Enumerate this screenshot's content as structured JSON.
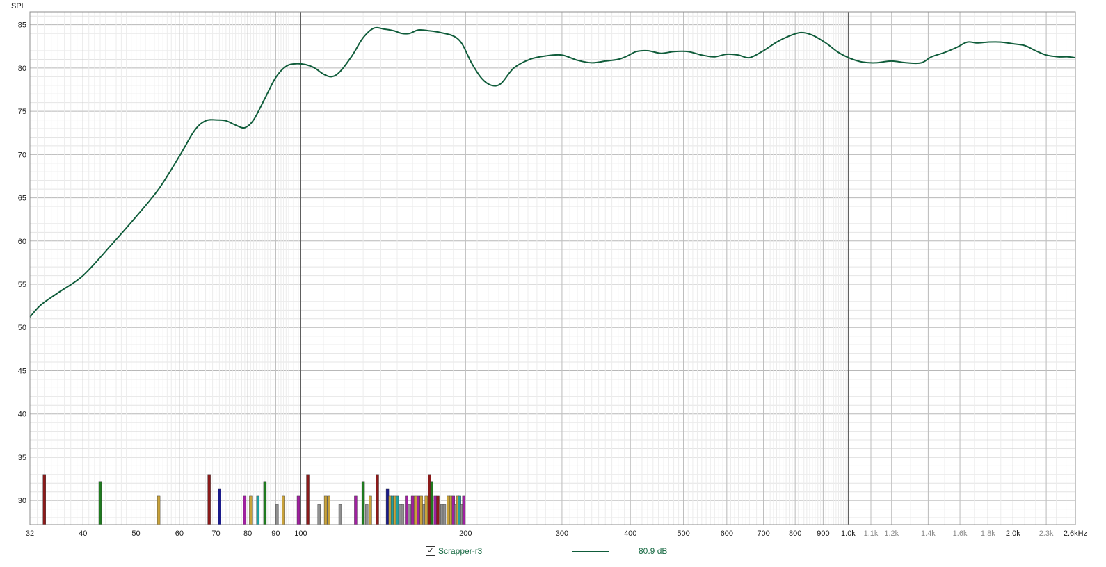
{
  "chart_data": {
    "type": "line",
    "ylabel": "SPL",
    "ylim": [
      27.2,
      86.5
    ],
    "xlim": [
      32,
      2600
    ],
    "xscale": "log",
    "grid": true,
    "y_ticks": [
      30,
      35,
      40,
      45,
      50,
      55,
      60,
      65,
      70,
      75,
      80,
      85
    ],
    "x_ticks": [
      {
        "v": 32,
        "t": "32",
        "minor": false
      },
      {
        "v": 40,
        "t": "40",
        "minor": false
      },
      {
        "v": 50,
        "t": "50",
        "minor": false
      },
      {
        "v": 60,
        "t": "60",
        "minor": false
      },
      {
        "v": 70,
        "t": "70",
        "minor": false
      },
      {
        "v": 80,
        "t": "80",
        "minor": false
      },
      {
        "v": 90,
        "t": "90",
        "minor": false
      },
      {
        "v": 100,
        "t": "100",
        "minor": false
      },
      {
        "v": 200,
        "t": "200",
        "minor": false
      },
      {
        "v": 300,
        "t": "300",
        "minor": false
      },
      {
        "v": 400,
        "t": "400",
        "minor": false
      },
      {
        "v": 500,
        "t": "500",
        "minor": false
      },
      {
        "v": 600,
        "t": "600",
        "minor": false
      },
      {
        "v": 700,
        "t": "700",
        "minor": false
      },
      {
        "v": 800,
        "t": "800",
        "minor": false
      },
      {
        "v": 900,
        "t": "900",
        "minor": false
      },
      {
        "v": 1000,
        "t": "1.0k",
        "minor": false
      },
      {
        "v": 1100,
        "t": "1.1k",
        "minor": true
      },
      {
        "v": 1200,
        "t": "1.2k",
        "minor": true
      },
      {
        "v": 1400,
        "t": "1.4k",
        "minor": true
      },
      {
        "v": 1600,
        "t": "1.6k",
        "minor": true
      },
      {
        "v": 1800,
        "t": "1.8k",
        "minor": true
      },
      {
        "v": 2000,
        "t": "2.0k",
        "minor": false
      },
      {
        "v": 2300,
        "t": "2.3k",
        "minor": true
      },
      {
        "v": 2600,
        "t": "2.6kHz",
        "minor": false
      }
    ],
    "series": [
      {
        "name": "Scrapper-r3",
        "color": "#0f5c3a",
        "points": [
          [
            32,
            51.2
          ],
          [
            33.5,
            52.6
          ],
          [
            36,
            54.0
          ],
          [
            40,
            56.0
          ],
          [
            45,
            59.5
          ],
          [
            50,
            62.8
          ],
          [
            55,
            66.0
          ],
          [
            60,
            69.8
          ],
          [
            64,
            72.8
          ],
          [
            67,
            73.9
          ],
          [
            70,
            74.0
          ],
          [
            73,
            73.9
          ],
          [
            76,
            73.4
          ],
          [
            79,
            73.1
          ],
          [
            82,
            74.0
          ],
          [
            86,
            76.5
          ],
          [
            90,
            78.9
          ],
          [
            94,
            80.2
          ],
          [
            98,
            80.5
          ],
          [
            102,
            80.4
          ],
          [
            106,
            80.0
          ],
          [
            110,
            79.3
          ],
          [
            114,
            79.0
          ],
          [
            118,
            79.6
          ],
          [
            124,
            81.4
          ],
          [
            130,
            83.5
          ],
          [
            136,
            84.6
          ],
          [
            142,
            84.5
          ],
          [
            148,
            84.3
          ],
          [
            153,
            84.0
          ],
          [
            158,
            84.0
          ],
          [
            164,
            84.4
          ],
          [
            172,
            84.3
          ],
          [
            180,
            84.1
          ],
          [
            190,
            83.7
          ],
          [
            197,
            82.8
          ],
          [
            205,
            80.6
          ],
          [
            214,
            78.8
          ],
          [
            223,
            78.0
          ],
          [
            232,
            78.2
          ],
          [
            245,
            80.0
          ],
          [
            262,
            81.0
          ],
          [
            280,
            81.4
          ],
          [
            300,
            81.5
          ],
          [
            320,
            80.9
          ],
          [
            340,
            80.6
          ],
          [
            360,
            80.8
          ],
          [
            380,
            81.0
          ],
          [
            395,
            81.4
          ],
          [
            410,
            81.9
          ],
          [
            430,
            82.0
          ],
          [
            455,
            81.7
          ],
          [
            480,
            81.9
          ],
          [
            510,
            81.9
          ],
          [
            540,
            81.5
          ],
          [
            570,
            81.3
          ],
          [
            600,
            81.6
          ],
          [
            630,
            81.5
          ],
          [
            660,
            81.2
          ],
          [
            700,
            82.0
          ],
          [
            740,
            83.0
          ],
          [
            780,
            83.7
          ],
          [
            820,
            84.1
          ],
          [
            860,
            83.8
          ],
          [
            910,
            82.9
          ],
          [
            960,
            81.8
          ],
          [
            1010,
            81.1
          ],
          [
            1060,
            80.7
          ],
          [
            1120,
            80.6
          ],
          [
            1200,
            80.8
          ],
          [
            1280,
            80.6
          ],
          [
            1360,
            80.6
          ],
          [
            1420,
            81.3
          ],
          [
            1500,
            81.8
          ],
          [
            1580,
            82.4
          ],
          [
            1650,
            83.0
          ],
          [
            1720,
            82.9
          ],
          [
            1800,
            83.0
          ],
          [
            1900,
            83.0
          ],
          [
            2000,
            82.8
          ],
          [
            2100,
            82.6
          ],
          [
            2200,
            82.0
          ],
          [
            2300,
            81.5
          ],
          [
            2420,
            81.3
          ],
          [
            2520,
            81.3
          ],
          [
            2600,
            81.2
          ]
        ]
      }
    ],
    "bars": {
      "floor": 27.2,
      "items": [
        {
          "f": 34,
          "v": 33.0,
          "c": "#8b1a1a"
        },
        {
          "f": 43,
          "v": 32.2,
          "c": "#1f7a1f"
        },
        {
          "f": 55,
          "v": 30.5,
          "c": "#c9a23a"
        },
        {
          "f": 68,
          "v": 33.0,
          "c": "#8b1a1a"
        },
        {
          "f": 71,
          "v": 31.3,
          "c": "#1a1a8b"
        },
        {
          "f": 79,
          "v": 30.5,
          "c": "#a020a0"
        },
        {
          "f": 81,
          "v": 30.5,
          "c": "#c9a23a"
        },
        {
          "f": 83.5,
          "v": 30.5,
          "c": "#20a0a0"
        },
        {
          "f": 86,
          "v": 32.2,
          "c": "#1f7a1f"
        },
        {
          "f": 90.5,
          "v": 29.5,
          "c": "#909090"
        },
        {
          "f": 93,
          "v": 30.5,
          "c": "#c9a23a"
        },
        {
          "f": 99,
          "v": 30.5,
          "c": "#a020a0"
        },
        {
          "f": 103,
          "v": 33.0,
          "c": "#8b1a1a"
        },
        {
          "f": 108,
          "v": 29.5,
          "c": "#909090"
        },
        {
          "f": 111,
          "v": 30.5,
          "c": "#c9a23a"
        },
        {
          "f": 112.5,
          "v": 30.5,
          "c": "#c9a23a"
        },
        {
          "f": 118,
          "v": 29.5,
          "c": "#909090"
        },
        {
          "f": 126,
          "v": 30.5,
          "c": "#a020a0"
        },
        {
          "f": 130,
          "v": 32.2,
          "c": "#1f7a1f"
        },
        {
          "f": 132,
          "v": 29.5,
          "c": "#909090"
        },
        {
          "f": 134,
          "v": 30.5,
          "c": "#c9a23a"
        },
        {
          "f": 138,
          "v": 33.0,
          "c": "#8b1a1a"
        },
        {
          "f": 144,
          "v": 31.3,
          "c": "#1a1a8b"
        },
        {
          "f": 145.5,
          "v": 30.5,
          "c": "#c9a23a"
        },
        {
          "f": 147,
          "v": 30.5,
          "c": "#20a0a0"
        },
        {
          "f": 148.5,
          "v": 30.5,
          "c": "#c9a23a"
        },
        {
          "f": 150,
          "v": 30.5,
          "c": "#20a0a0"
        },
        {
          "f": 152,
          "v": 29.5,
          "c": "#909090"
        },
        {
          "f": 153.5,
          "v": 29.5,
          "c": "#909090"
        },
        {
          "f": 156,
          "v": 30.5,
          "c": "#a020a0"
        },
        {
          "f": 158,
          "v": 29.5,
          "c": "#909090"
        },
        {
          "f": 160,
          "v": 30.5,
          "c": "#a020a0"
        },
        {
          "f": 162,
          "v": 30.5,
          "c": "#c9a23a"
        },
        {
          "f": 164,
          "v": 30.5,
          "c": "#a020a0"
        },
        {
          "f": 166,
          "v": 30.5,
          "c": "#c9a23a"
        },
        {
          "f": 168,
          "v": 29.5,
          "c": "#909090"
        },
        {
          "f": 169.5,
          "v": 30.5,
          "c": "#c9a23a"
        },
        {
          "f": 172,
          "v": 33.0,
          "c": "#8b1a1a"
        },
        {
          "f": 173.5,
          "v": 32.2,
          "c": "#1f7a1f"
        },
        {
          "f": 176,
          "v": 30.5,
          "c": "#a020a0"
        },
        {
          "f": 178,
          "v": 30.5,
          "c": "#8b1a1a"
        },
        {
          "f": 181,
          "v": 29.5,
          "c": "#909090"
        },
        {
          "f": 183,
          "v": 29.5,
          "c": "#909090"
        },
        {
          "f": 186,
          "v": 30.5,
          "c": "#c9a23a"
        },
        {
          "f": 188,
          "v": 30.5,
          "c": "#c9a23a"
        },
        {
          "f": 190,
          "v": 30.5,
          "c": "#a020a0"
        },
        {
          "f": 192,
          "v": 29.5,
          "c": "#909090"
        },
        {
          "f": 193.5,
          "v": 30.5,
          "c": "#c9a23a"
        },
        {
          "f": 195,
          "v": 30.5,
          "c": "#20a0a0"
        },
        {
          "f": 197,
          "v": 29.5,
          "c": "#909090"
        },
        {
          "f": 198.5,
          "v": 30.5,
          "c": "#a020a0"
        }
      ]
    }
  },
  "legend": {
    "name": "Scrapper-r3",
    "value": "80.9 dB",
    "checked": "✓",
    "color": "#0f5c3a"
  }
}
